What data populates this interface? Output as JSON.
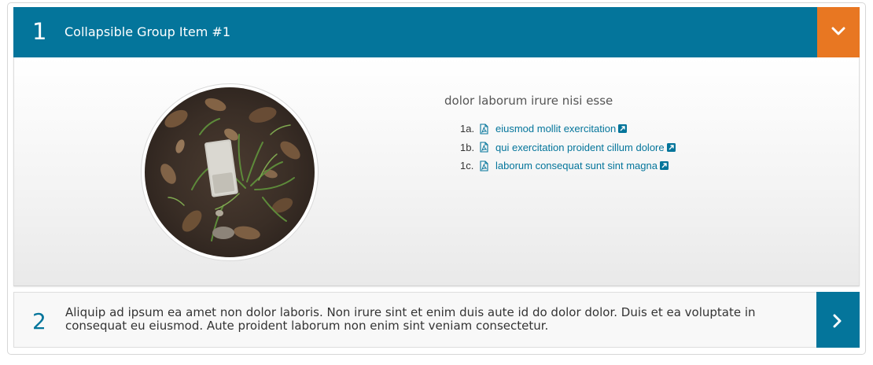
{
  "accordion": {
    "items": [
      {
        "number": "1",
        "title": "Collapsible Group Item #1",
        "state": "expanded",
        "toggle_color": "#e87722",
        "toggle_icon": "chevron-down-icon",
        "content": {
          "image": "circular photo of grass and leaves on soil with a piece of paper",
          "heading": "dolor laborum irure nisi esse",
          "links": [
            {
              "index": "1a.",
              "icon": "pdf-icon",
              "label": "eiusmod mollit exercitation",
              "external_icon": "external-link-icon"
            },
            {
              "index": "1b.",
              "icon": "pdf-icon",
              "label": "qui exercitation proident cillum dolore",
              "external_icon": "external-link-icon"
            },
            {
              "index": "1c.",
              "icon": "pdf-icon",
              "label": "laborum consequat sunt sint magna",
              "external_icon": "external-link-icon"
            }
          ]
        }
      },
      {
        "number": "2",
        "title": "Aliquip ad ipsum ea amet non dolor laboris. Non irure sint et enim duis aute id do dolor dolor. Duis et ea voluptate in consequat eu eiusmod. Aute proident laborum non enim sint veniam consectetur.",
        "state": "collapsed",
        "toggle_color": "#04759b",
        "toggle_icon": "chevron-right-icon"
      }
    ]
  },
  "colors": {
    "primary": "#04759b",
    "accent": "#e87722"
  }
}
